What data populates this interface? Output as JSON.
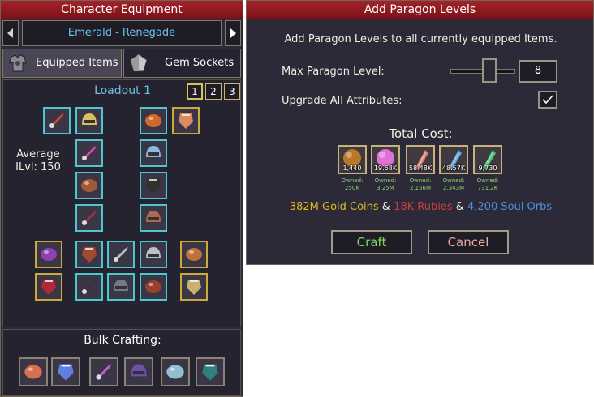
{
  "equipment": {
    "title": "Character Equipment",
    "character_name": "Emerald - Renegade",
    "prev_icon": "triangle-left-icon",
    "next_icon": "triangle-right-icon",
    "tabs": [
      {
        "label": "Equipped Items",
        "icon": "armor-icon"
      },
      {
        "label": "Gem Sockets",
        "icon": "gem-icon"
      }
    ],
    "loadout_title": "Loadout 1",
    "loadouts": [
      "1",
      "2",
      "3"
    ],
    "active_loadout": "1",
    "average_label": "Average",
    "ilvl_label": "ILvl: 150",
    "slots": [
      {
        "name": "weapon-slot",
        "icon": "sword-icon",
        "color": "#c54a3a",
        "frame": "cyan"
      },
      {
        "name": "helmet-slot",
        "icon": "helmet-icon",
        "color": "#d8c060",
        "frame": "cyan"
      },
      {
        "name": "hair-slot",
        "icon": "hair-icon",
        "color": "#d06a2a",
        "frame": "cyan"
      },
      {
        "name": "offhand-slot",
        "icon": "hand-icon",
        "color": "#d88c60",
        "frame": "gold"
      },
      {
        "name": "shoulder-slot",
        "icon": "shoulder-icon",
        "color": "#d848a0",
        "frame": "cyan"
      },
      {
        "name": "amulet-slot",
        "icon": "amulet-icon",
        "color": "#8ab8e0",
        "frame": "cyan"
      },
      {
        "name": "chest-slot",
        "icon": "chest-icon",
        "color": "#a05a38",
        "frame": "cyan"
      },
      {
        "name": "cloak-slot",
        "icon": "cloak-icon",
        "color": "#303030",
        "frame": "cyan"
      },
      {
        "name": "bracer-slot",
        "icon": "bracer-icon",
        "color": "#9a3040",
        "frame": "cyan"
      },
      {
        "name": "boots-slot",
        "icon": "boots-icon",
        "color": "#b06850",
        "frame": "cyan"
      },
      {
        "name": "ring-slot-1",
        "icon": "ring-icon",
        "color": "#9040b0",
        "frame": "gold"
      },
      {
        "name": "belt-slot",
        "icon": "belt-icon",
        "color": "#a04a30",
        "frame": "cyan"
      },
      {
        "name": "bracelet-slot-1",
        "icon": "bracelet-icon",
        "color": "#b8c0c8",
        "frame": "cyan"
      },
      {
        "name": "bracelet-slot-2",
        "icon": "bracelet-icon",
        "color": "#b8c0c8",
        "frame": "cyan"
      },
      {
        "name": "trinket-slot",
        "icon": "talisman-icon",
        "color": "#c0703a",
        "frame": "gold"
      },
      {
        "name": "glove-slot",
        "icon": "glove-icon",
        "color": "#b02838",
        "frame": "gold"
      },
      {
        "name": "pants-slot",
        "icon": "pants-icon",
        "color": "#40303a",
        "frame": "cyan"
      },
      {
        "name": "rune-slot",
        "icon": "rune-stone-icon",
        "color": "#707a8a",
        "frame": "cyan"
      },
      {
        "name": "potion-slot",
        "icon": "potion-icon",
        "color": "#9a4030",
        "frame": "cyan"
      },
      {
        "name": "scroll-slot",
        "icon": "scroll-icon",
        "color": "#c8b070",
        "frame": "gold"
      }
    ],
    "bulk_title": "Bulk Crafting:",
    "bulk_items": [
      {
        "icon": "forge-icon",
        "color": "#d87050"
      },
      {
        "icon": "feather-icon",
        "color": "#6080e0"
      },
      {
        "icon": "orb-icon",
        "color": "#c060d0"
      },
      {
        "icon": "anvil-icon",
        "color": "#7050b0"
      },
      {
        "icon": "silver-orb-icon",
        "color": "#90c0d0"
      },
      {
        "icon": "anvil-teal-icon",
        "color": "#308080"
      }
    ]
  },
  "paragon": {
    "title": "Add Paragon Levels",
    "description": "Add Paragon Levels to all currently equipped Items.",
    "max_level_label": "Max Paragon Level:",
    "max_level_value": "8",
    "slider_value_fraction": 0.6,
    "upgrade_all_label": "Upgrade All Attributes:",
    "upgrade_all_checked": true,
    "total_cost_label": "Total Cost:",
    "costs": [
      {
        "count": "1,440",
        "owned_label": "Owned:",
        "owned": "250K",
        "icon": "bronze-orb-icon",
        "color": "#b87828"
      },
      {
        "count": "19.68K",
        "owned_label": "Owned:",
        "owned": "3.25M",
        "icon": "pink-orb-icon",
        "color": "#e070d8"
      },
      {
        "count": "58.48K",
        "owned_label": "Owned:",
        "owned": "2.156M",
        "icon": "pink-crystal-icon",
        "color": "#e08070"
      },
      {
        "count": "48.57K",
        "owned_label": "Owned:",
        "owned": "2.343M",
        "icon": "blue-crystal-icon",
        "color": "#60a8e0"
      },
      {
        "count": "9,730",
        "owned_label": "Owned:",
        "owned": "731.2K",
        "icon": "green-crystal-icon",
        "color": "#50c070"
      }
    ],
    "currency": {
      "gold": "382M Gold Coins",
      "sep1": " & ",
      "rubies": "18K Rubies",
      "sep2": " & ",
      "orbs": "4,200 Soul Orbs",
      "gold_color": "#e0b820",
      "rubies_color": "#c84040",
      "orbs_color": "#4a90e0"
    },
    "craft_label": "Craft",
    "cancel_label": "Cancel",
    "craft_color": "#7ed860",
    "cancel_color": "#f0a8a0"
  }
}
